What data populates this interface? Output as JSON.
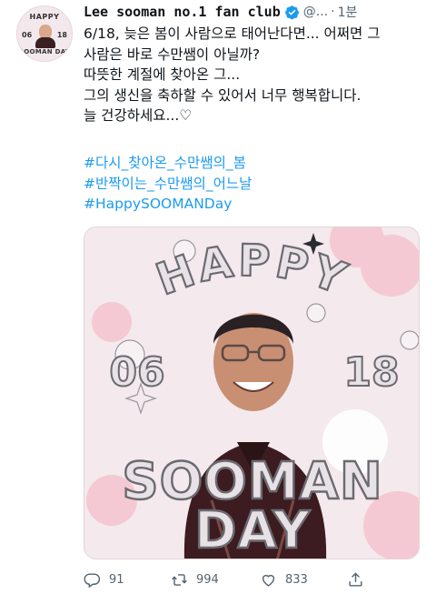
{
  "tweet": {
    "display_name": "Lee sooman no.1 fan club",
    "handle": "@...",
    "time": "1분",
    "lines": [
      "6/18, 늦은 봄이 사람으로 태어난다면... 어쩌면 그",
      "사람은 바로 수만쌤이 아닐까?",
      "따뜻한 계절에 찾아온 그...",
      "그의 생신을 축하할 수 있어서 너무 행복합니다.",
      "늘 건강하세요...♡"
    ],
    "hashtags": [
      "#다시_찾아온_수만쌤의_봄",
      "#반짝이는_수만쌤의_어느날",
      "#HappySOOMANDay"
    ]
  },
  "avatar": {
    "top": "HAPPY",
    "left": "06",
    "right": "18",
    "bottom": "SOOMAN DAY"
  },
  "image": {
    "title_top": "HAPPY",
    "date_left": "06",
    "date_right": "18",
    "title_mid": "SOOMAN",
    "title_bottom": "DAY"
  },
  "actions": {
    "replies": "91",
    "retweets": "994",
    "likes": "833"
  },
  "colors": {
    "link": "#1d9bf0",
    "muted": "#536471",
    "verified": "#1d9bf0",
    "poster_bg": "#f4e9ec",
    "poster_pink": "#f5c9d3",
    "poster_text": "#e8e2e6",
    "poster_outline": "#6b6a70"
  }
}
